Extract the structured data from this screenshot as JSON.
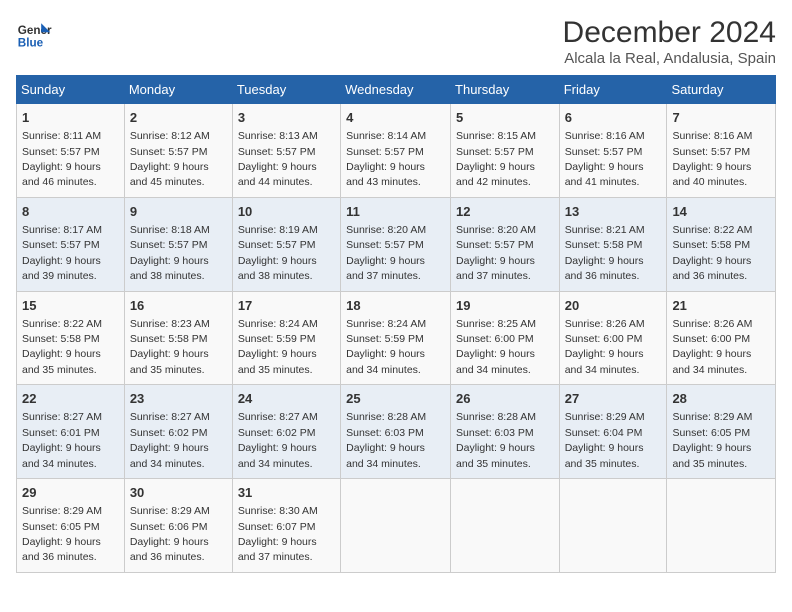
{
  "logo": {
    "text_general": "General",
    "text_blue": "Blue"
  },
  "header": {
    "title": "December 2024",
    "subtitle": "Alcala la Real, Andalusia, Spain"
  },
  "weekdays": [
    "Sunday",
    "Monday",
    "Tuesday",
    "Wednesday",
    "Thursday",
    "Friday",
    "Saturday"
  ],
  "weeks": [
    [
      {
        "day": "1",
        "sunrise": "8:11 AM",
        "sunset": "5:57 PM",
        "daylight": "9 hours and 46 minutes."
      },
      {
        "day": "2",
        "sunrise": "8:12 AM",
        "sunset": "5:57 PM",
        "daylight": "9 hours and 45 minutes."
      },
      {
        "day": "3",
        "sunrise": "8:13 AM",
        "sunset": "5:57 PM",
        "daylight": "9 hours and 44 minutes."
      },
      {
        "day": "4",
        "sunrise": "8:14 AM",
        "sunset": "5:57 PM",
        "daylight": "9 hours and 43 minutes."
      },
      {
        "day": "5",
        "sunrise": "8:15 AM",
        "sunset": "5:57 PM",
        "daylight": "9 hours and 42 minutes."
      },
      {
        "day": "6",
        "sunrise": "8:16 AM",
        "sunset": "5:57 PM",
        "daylight": "9 hours and 41 minutes."
      },
      {
        "day": "7",
        "sunrise": "8:16 AM",
        "sunset": "5:57 PM",
        "daylight": "9 hours and 40 minutes."
      }
    ],
    [
      {
        "day": "8",
        "sunrise": "8:17 AM",
        "sunset": "5:57 PM",
        "daylight": "9 hours and 39 minutes."
      },
      {
        "day": "9",
        "sunrise": "8:18 AM",
        "sunset": "5:57 PM",
        "daylight": "9 hours and 38 minutes."
      },
      {
        "day": "10",
        "sunrise": "8:19 AM",
        "sunset": "5:57 PM",
        "daylight": "9 hours and 38 minutes."
      },
      {
        "day": "11",
        "sunrise": "8:20 AM",
        "sunset": "5:57 PM",
        "daylight": "9 hours and 37 minutes."
      },
      {
        "day": "12",
        "sunrise": "8:20 AM",
        "sunset": "5:57 PM",
        "daylight": "9 hours and 37 minutes."
      },
      {
        "day": "13",
        "sunrise": "8:21 AM",
        "sunset": "5:58 PM",
        "daylight": "9 hours and 36 minutes."
      },
      {
        "day": "14",
        "sunrise": "8:22 AM",
        "sunset": "5:58 PM",
        "daylight": "9 hours and 36 minutes."
      }
    ],
    [
      {
        "day": "15",
        "sunrise": "8:22 AM",
        "sunset": "5:58 PM",
        "daylight": "9 hours and 35 minutes."
      },
      {
        "day": "16",
        "sunrise": "8:23 AM",
        "sunset": "5:58 PM",
        "daylight": "9 hours and 35 minutes."
      },
      {
        "day": "17",
        "sunrise": "8:24 AM",
        "sunset": "5:59 PM",
        "daylight": "9 hours and 35 minutes."
      },
      {
        "day": "18",
        "sunrise": "8:24 AM",
        "sunset": "5:59 PM",
        "daylight": "9 hours and 34 minutes."
      },
      {
        "day": "19",
        "sunrise": "8:25 AM",
        "sunset": "6:00 PM",
        "daylight": "9 hours and 34 minutes."
      },
      {
        "day": "20",
        "sunrise": "8:26 AM",
        "sunset": "6:00 PM",
        "daylight": "9 hours and 34 minutes."
      },
      {
        "day": "21",
        "sunrise": "8:26 AM",
        "sunset": "6:00 PM",
        "daylight": "9 hours and 34 minutes."
      }
    ],
    [
      {
        "day": "22",
        "sunrise": "8:27 AM",
        "sunset": "6:01 PM",
        "daylight": "9 hours and 34 minutes."
      },
      {
        "day": "23",
        "sunrise": "8:27 AM",
        "sunset": "6:02 PM",
        "daylight": "9 hours and 34 minutes."
      },
      {
        "day": "24",
        "sunrise": "8:27 AM",
        "sunset": "6:02 PM",
        "daylight": "9 hours and 34 minutes."
      },
      {
        "day": "25",
        "sunrise": "8:28 AM",
        "sunset": "6:03 PM",
        "daylight": "9 hours and 34 minutes."
      },
      {
        "day": "26",
        "sunrise": "8:28 AM",
        "sunset": "6:03 PM",
        "daylight": "9 hours and 35 minutes."
      },
      {
        "day": "27",
        "sunrise": "8:29 AM",
        "sunset": "6:04 PM",
        "daylight": "9 hours and 35 minutes."
      },
      {
        "day": "28",
        "sunrise": "8:29 AM",
        "sunset": "6:05 PM",
        "daylight": "9 hours and 35 minutes."
      }
    ],
    [
      {
        "day": "29",
        "sunrise": "8:29 AM",
        "sunset": "6:05 PM",
        "daylight": "9 hours and 36 minutes."
      },
      {
        "day": "30",
        "sunrise": "8:29 AM",
        "sunset": "6:06 PM",
        "daylight": "9 hours and 36 minutes."
      },
      {
        "day": "31",
        "sunrise": "8:30 AM",
        "sunset": "6:07 PM",
        "daylight": "9 hours and 37 minutes."
      },
      null,
      null,
      null,
      null
    ]
  ]
}
